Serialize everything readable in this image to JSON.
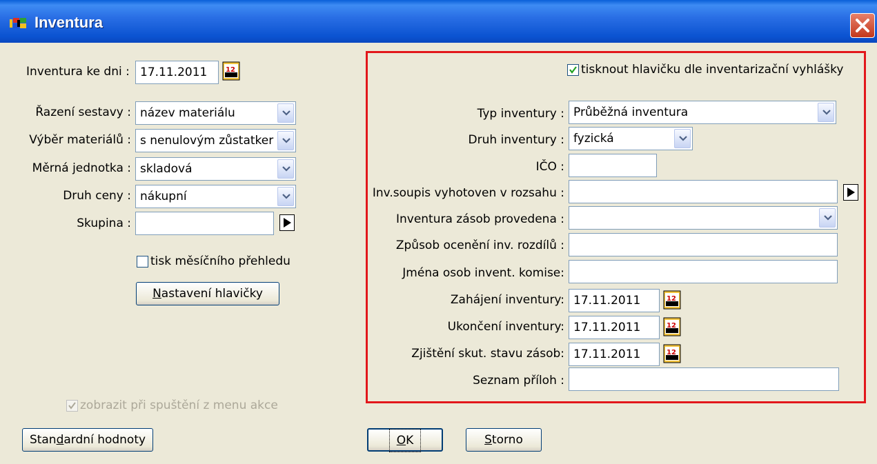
{
  "window": {
    "title": "Inventura"
  },
  "left": {
    "inventura_ke_dni": {
      "label": "Inventura ke dni :",
      "value": "17.11.2011"
    },
    "razeni": {
      "label": "Řazení sestavy :",
      "value": "název materiálu"
    },
    "vyber": {
      "label": "Výběr materiálů :",
      "value": "s nenulovým zůstatker"
    },
    "jednotka": {
      "label": "Měrná jednotka :",
      "value": "skladová"
    },
    "cena": {
      "label": "Druh ceny :",
      "value": "nákupní"
    },
    "skupina": {
      "label": "Skupina :",
      "value": ""
    },
    "tisk_mesicniho": {
      "label": "tisk měsíčního přehledu",
      "checked": false
    },
    "nastaveni_hlavicky": {
      "label_pre": "",
      "label_u": "N",
      "label_post": "astavení hlavičky"
    },
    "zobrazit": {
      "label": "zobrazit při spuštění z menu akce",
      "checked": true,
      "disabled": true
    }
  },
  "right": {
    "tisknout_hlavicku": {
      "label": "tisknout hlavičku dle inventarizační vyhlášky",
      "checked": true
    },
    "typ": {
      "label": "Typ inventury :",
      "value": "Průběžná inventura"
    },
    "druh": {
      "label": "Druh inventury :",
      "value": "fyzická"
    },
    "ico": {
      "label": "IČO :",
      "value": ""
    },
    "soupis": {
      "label": "Inv.soupis vyhotoven v rozsahu :",
      "value": ""
    },
    "provedena": {
      "label": "Inventura zásob provedena :",
      "value": ""
    },
    "zpusob": {
      "label": "Způsob ocenění inv. rozdílů :",
      "value": ""
    },
    "jmena": {
      "label": "Jména osob invent. komise:",
      "value": ""
    },
    "zahajeni": {
      "label": "Zahájení inventury:",
      "value": "17.11.2011"
    },
    "ukonceni": {
      "label": "Ukončení inventury:",
      "value": "17.11.2011"
    },
    "zjisteni": {
      "label": "Zjištění skut. stavu zásob:",
      "value": "17.11.2011"
    },
    "prilohy": {
      "label": "Seznam příloh :",
      "value": ""
    }
  },
  "buttons": {
    "standard": {
      "pre": "Stan",
      "u": "d",
      "post": "ardní hodnoty"
    },
    "ok": {
      "pre": "",
      "u": "O",
      "post": "K"
    },
    "storno": {
      "pre": "",
      "u": "S",
      "post": "torno"
    }
  },
  "icons": {
    "title": "app-icon",
    "close": "close-icon",
    "calendar": "calendar-icon",
    "dropdown": "chevron-down-icon",
    "arrow": "play-arrow-icon",
    "check": "checkmark-icon"
  },
  "colors": {
    "titlebar": "#0b53d1",
    "highlight_border": "#e2171b",
    "face": "#ece9d8"
  }
}
